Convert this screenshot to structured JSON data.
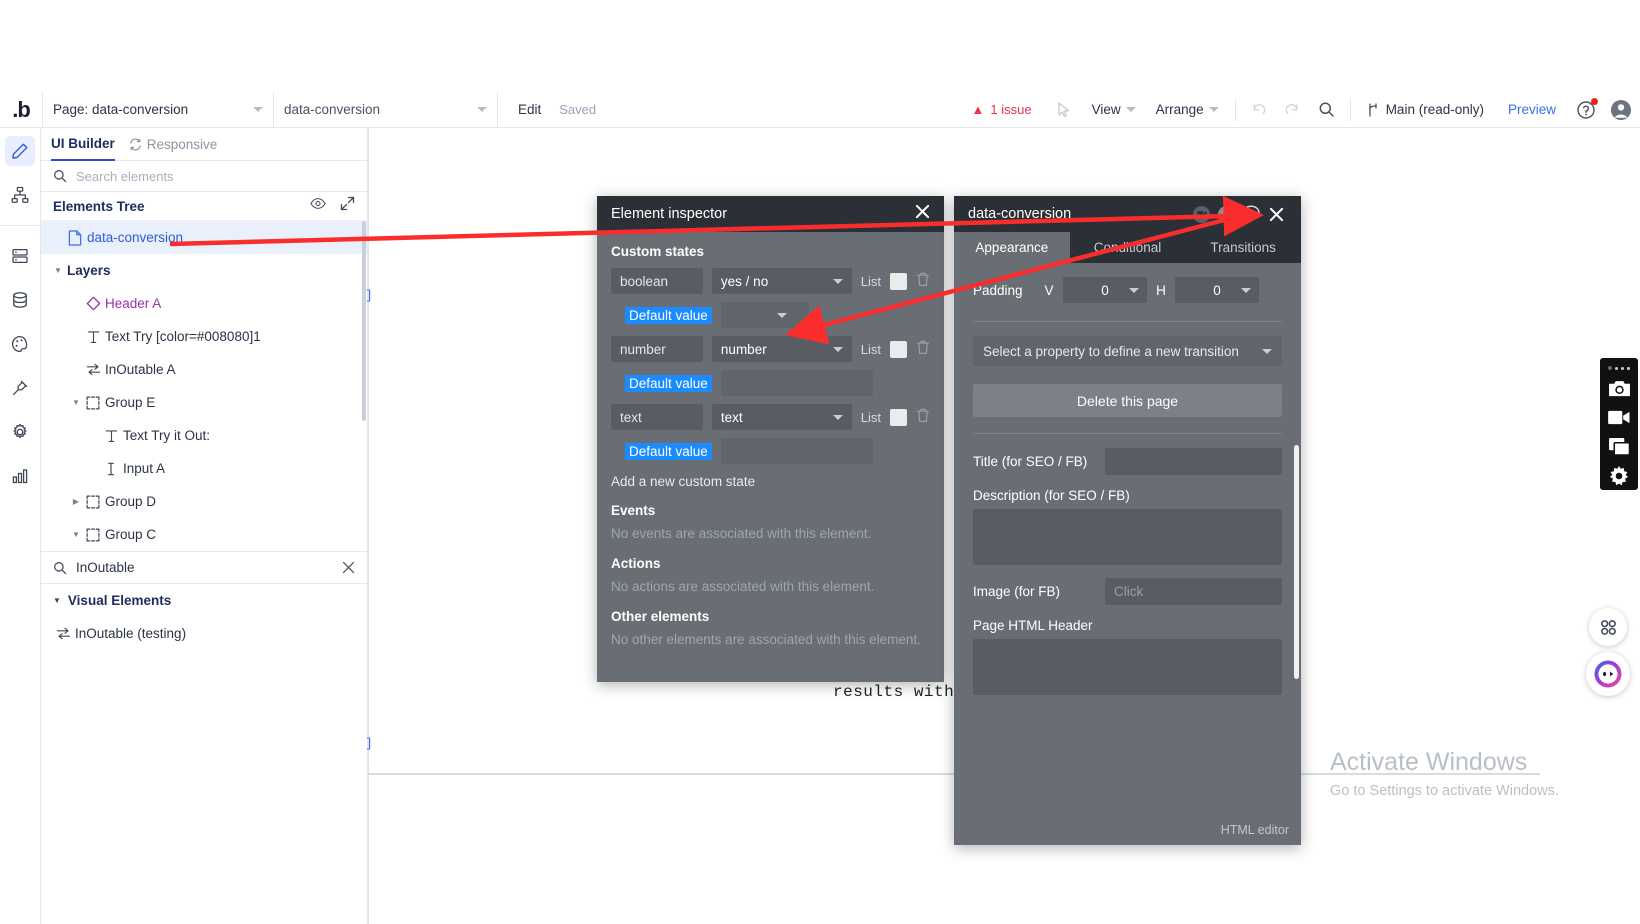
{
  "app": {
    "logo": ".b"
  },
  "topbar": {
    "page_select": "Page: data-conversion",
    "element_select": "data-conversion",
    "edit_label": "Edit",
    "saved_label": "Saved",
    "issue_count": "1 issue",
    "view_label": "View",
    "arrange_label": "Arrange",
    "branch_label": "Main (read-only)",
    "preview_label": "Preview"
  },
  "rail": {
    "items": [
      {
        "name": "design-pencil",
        "active": true
      },
      {
        "name": "workflow"
      },
      {
        "name": "data-rows"
      },
      {
        "name": "database"
      },
      {
        "name": "styles-palette"
      },
      {
        "name": "plugins"
      },
      {
        "name": "settings-gear"
      },
      {
        "name": "logs-chart"
      }
    ]
  },
  "left_panel": {
    "tabs": [
      {
        "label": "UI Builder",
        "active": true
      },
      {
        "label": "Responsive",
        "active": false
      }
    ],
    "search_placeholder": "Search elements",
    "tree_title": "Elements Tree",
    "tree": [
      {
        "label": "data-conversion",
        "icon": "page-icon",
        "depth": 0,
        "selected": true,
        "arrow": ""
      },
      {
        "label": "Layers",
        "icon": "",
        "depth": 0,
        "selected": false,
        "arrow": "down",
        "bold": true
      },
      {
        "label": "Header A",
        "icon": "diamond-icon",
        "depth": 1,
        "selected": false,
        "arrow": "",
        "purple": true
      },
      {
        "label": "Text Try [color=#008080]1",
        "icon": "text-icon",
        "depth": 1,
        "selected": false,
        "arrow": ""
      },
      {
        "label": "InOutable A",
        "icon": "inoutable-icon",
        "depth": 1,
        "selected": false,
        "arrow": ""
      },
      {
        "label": "Group E",
        "icon": "group-icon",
        "depth": 1,
        "selected": false,
        "arrow": "down"
      },
      {
        "label": "Text Try it Out:",
        "icon": "text-icon",
        "depth": 2,
        "selected": false,
        "arrow": ""
      },
      {
        "label": "Input A",
        "icon": "input-icon",
        "depth": 2,
        "selected": false,
        "arrow": ""
      },
      {
        "label": "Group D",
        "icon": "group-icon",
        "depth": 1,
        "selected": false,
        "arrow": "right"
      },
      {
        "label": "Group C",
        "icon": "group-icon",
        "depth": 1,
        "selected": false,
        "arrow": "down"
      }
    ],
    "filter_value": "InOutable",
    "visual_elements_title": "Visual Elements",
    "visual_elements": [
      {
        "label": "InOutable (testing)",
        "icon": "inoutable-icon"
      }
    ]
  },
  "canvas": {
    "mono_text": "results with,",
    "bracket": "]"
  },
  "inspector": {
    "title": "Element inspector",
    "custom_states_title": "Custom states",
    "list_label": "List",
    "states": [
      {
        "name": "boolean",
        "type": "yes / no",
        "default_label": "Default value",
        "default_kind": "select",
        "default_value": ""
      },
      {
        "name": "number",
        "type": "number",
        "default_label": "Default value",
        "default_kind": "text",
        "default_value": ""
      },
      {
        "name": "text",
        "type": "text",
        "default_label": "Default value",
        "default_kind": "text",
        "default_value": ""
      }
    ],
    "add_state_label": "Add a new custom state",
    "events_title": "Events",
    "events_empty": "No events are associated with this element.",
    "actions_title": "Actions",
    "actions_empty": "No actions are associated with this element.",
    "other_title": "Other elements",
    "other_empty": "No other elements are associated with this element."
  },
  "dataconv": {
    "title": "data-conversion",
    "tabs": [
      {
        "label": "Appearance",
        "active": true
      },
      {
        "label": "Conditional",
        "active": false
      },
      {
        "label": "Transitions",
        "active": false
      }
    ],
    "padding_label": "Padding",
    "padding_v_axis": "V",
    "padding_v_value": "0",
    "padding_h_axis": "H",
    "padding_h_value": "0",
    "transition_placeholder": "Select a property to define a new transition",
    "delete_label": "Delete this page",
    "seo_title_label": "Title (for SEO / FB)",
    "seo_title_value": "",
    "seo_desc_label": "Description (for SEO / FB)",
    "seo_desc_value": "",
    "seo_image_label": "Image (for FB)",
    "seo_image_value": "Click",
    "page_html_label": "Page HTML Header",
    "page_html_value": "",
    "html_editor_label": "HTML editor"
  },
  "right_toolbar": {
    "icons": [
      "camera-icon",
      "video-icon",
      "window-icon",
      "gear-icon"
    ]
  },
  "watermark": {
    "line1": "Activate Windows",
    "line2": "Go to Settings to activate Windows."
  }
}
